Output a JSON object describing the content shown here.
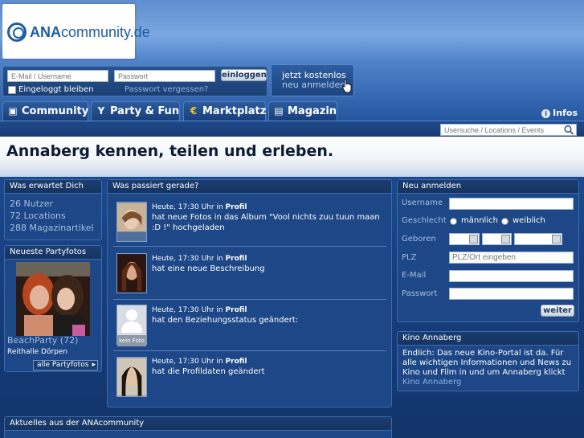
{
  "logo": {
    "brand_bold": "ANA",
    "brand_rest": "community.de"
  },
  "login": {
    "email_placeholder": "E-Mail / Username",
    "password_placeholder": "Passwort",
    "login_button": "einloggen",
    "stay_logged_in": "Eingeloggt bleiben",
    "forgot_password": "Passwort vergessen?",
    "register_line1": "jetzt kostenlos",
    "register_line2": "neu anmelden"
  },
  "nav": {
    "tabs": [
      {
        "label": "Community",
        "icon": "community-icon"
      },
      {
        "label": "Party & Fun",
        "icon": "cocktail-icon"
      },
      {
        "label": "Marktplatz",
        "icon": "euro-icon"
      },
      {
        "label": "Magazin",
        "icon": "magazine-icon"
      }
    ],
    "infos": "Infos"
  },
  "search": {
    "placeholder": "Usersuche / Locations / Events"
  },
  "hero": {
    "title": "Annaberg kennen, teilen und erleben."
  },
  "left": {
    "expect_title": "Was erwartet Dich",
    "stats": [
      "26 Nutzer",
      "72 Locations",
      "288 Magazinartikel"
    ],
    "photos_title": "Neueste Partyfotos",
    "photo_caption": "BeachParty (72)",
    "photo_venue": "Reithalle Dörpen",
    "all_photos": "alle Partyfotos"
  },
  "feed": {
    "title": "Was passiert gerade?",
    "items": [
      {
        "time": "Heute, 17:30 Uhr in",
        "where": "Profil",
        "text": "hat neue Fotos in das Album \"Vool nichts zuu tuun maan :D !\" hochgeladen"
      },
      {
        "time": "Heute, 17:30 Uhr in",
        "where": "Profil",
        "text": "hat eine neue Beschreibung"
      },
      {
        "time": "Heute, 17:30 Uhr in",
        "where": "Profil",
        "text": "hat den Beziehungsstatus geändert:",
        "no_photo": "kein Foto"
      },
      {
        "time": "Heute, 17:30 Uhr in",
        "where": "Profil",
        "text": "hat die Profildaten geändert"
      }
    ]
  },
  "register": {
    "title": "Neu anmelden",
    "username": "Username",
    "gender": "Geschlecht",
    "male": "männlich",
    "female": "weiblich",
    "born": "Geboren",
    "zip": "PLZ",
    "zip_placeholder": "PLZ/Ort eingeben",
    "email": "E-Mail",
    "password": "Passwort",
    "next_button": "weiter"
  },
  "kino": {
    "title": "Kino Annaberg",
    "text": "Endlich: Das neue Kino-Portal ist da. Für alle wichtigen Informationen und News zu Kino und Film in und um Annaberg klickt",
    "link": "Kino Annaberg"
  },
  "news": {
    "title": "Aktuelles aus der ANAcommunity"
  }
}
